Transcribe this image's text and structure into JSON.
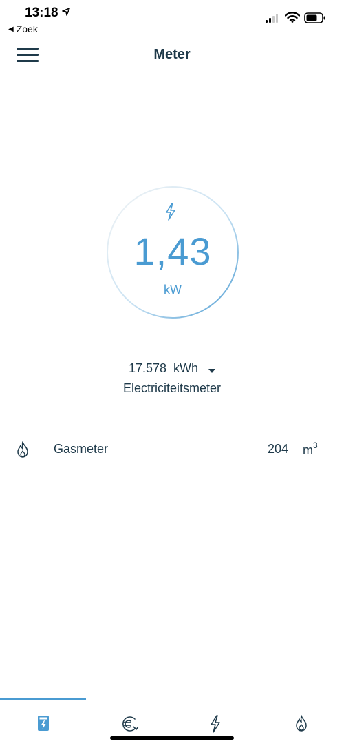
{
  "status_bar": {
    "time": "13:18",
    "back_label": "Zoek"
  },
  "header": {
    "title": "Meter"
  },
  "gauge": {
    "value": "1,43",
    "unit": "kW"
  },
  "meter": {
    "reading": "17.578",
    "reading_unit": "kWh",
    "name": "Electriciteitsmeter"
  },
  "gas": {
    "label": "Gasmeter",
    "value": "204",
    "unit": "m",
    "unit_exponent": "3"
  },
  "tabs": [
    {
      "icon": "meter-icon",
      "active": true
    },
    {
      "icon": "euro-icon",
      "active": false
    },
    {
      "icon": "lightning-icon",
      "active": false
    },
    {
      "icon": "flame-icon",
      "active": false
    }
  ],
  "colors": {
    "accent": "#4a9bd2",
    "text": "#1f3a4a"
  }
}
